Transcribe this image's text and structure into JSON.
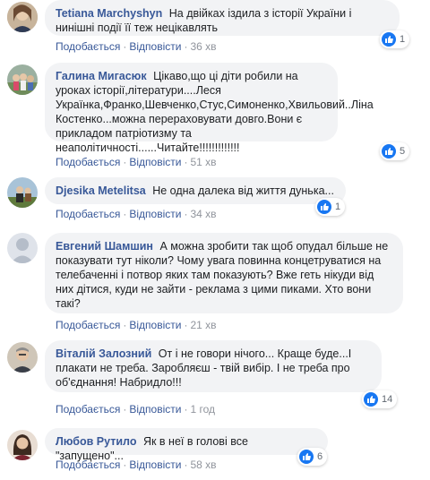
{
  "actions": {
    "like": "Подобається",
    "reply": "Відповісти",
    "sep": "·"
  },
  "colors": {
    "link": "#385898",
    "like": "#1877f2",
    "bubble": "#f2f3f5"
  },
  "comments": [
    {
      "author": "Tetiana Marchyshyn",
      "text": "На двійках іздила з історії України і нинішні події її теж нецікавлять",
      "time": "36 хв",
      "likes": "1"
    },
    {
      "author": "Галина Мигасюк",
      "text": "Цікаво,що ці діти робили на уроках історії,літератури....Леся Українка,Франко,Шевченко,Стус,Симоненко,Хвильовий..Ліна Костенко...можна перераховувати довго.Вони є прикладом патріотизму та неаполітичності......Читайте!!!!!!!!!!!!!",
      "time": "51 хв",
      "likes": "5"
    },
    {
      "author": "Djesika Metelitsa",
      "text": "Не одна далека від життя дунька...",
      "time": "34 хв",
      "likes": "1"
    },
    {
      "author": "Евгений Шамшин",
      "text": "А можна зробити так щоб опудал більше не показувати тут ніколи? Чому увага повинна концетруватися на телебаченні і потвор яких там показують? Вже геть нікуди від них дітися, куди не зайти - реклама з цими пиками. Хто вони такі?",
      "time": "21 хв",
      "likes": ""
    },
    {
      "author": "Віталій Залозний",
      "text": "От і не говори нічого... Краще буде...І плакати не треба. Заробляєш - твій вибір. І не треба про об'єднання! Набридло!!!",
      "time": "1 год",
      "likes": "14"
    },
    {
      "author": "Любов Рутило",
      "text": "Як в неї в голові все \"запущено\"...",
      "time": "58 хв",
      "likes": "6"
    }
  ]
}
